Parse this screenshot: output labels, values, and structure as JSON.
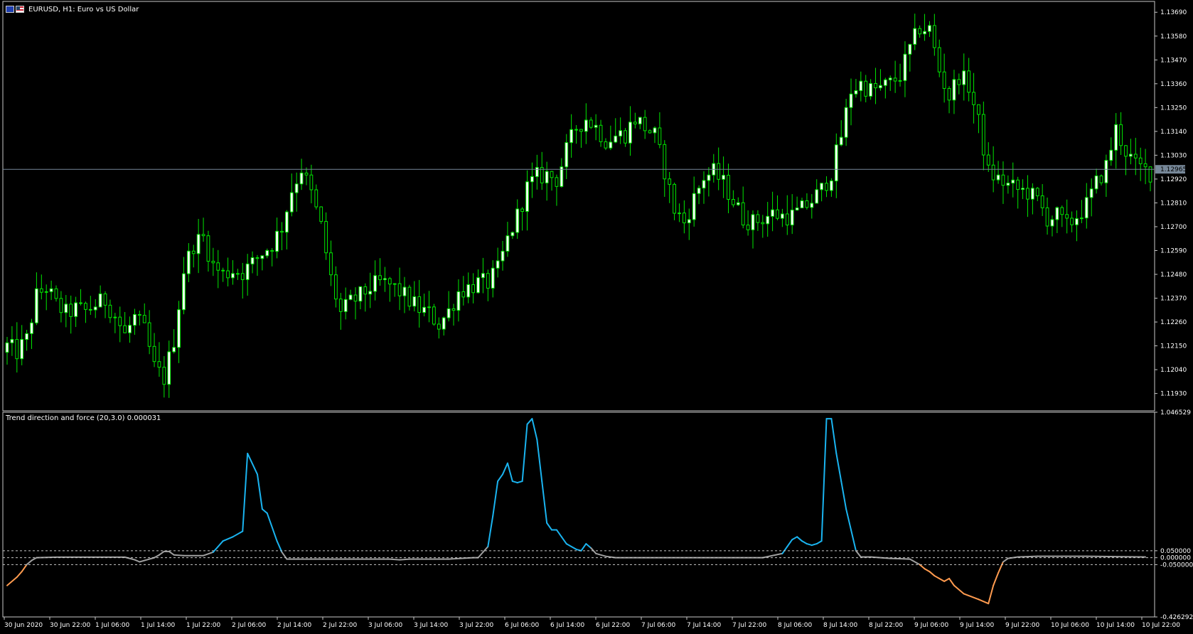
{
  "header": {
    "symbol_title": "EURUSD, H1:  Euro vs US Dollar",
    "flag_left_icon": "eu-flag-icon",
    "flag_right_icon": "us-flag-icon"
  },
  "price_pane": {
    "axis_labels": [
      "1.13690",
      "1.13580",
      "1.13470",
      "1.13360",
      "1.13250",
      "1.13140",
      "1.13030",
      "1.12920",
      "1.12810",
      "1.12700",
      "1.12590",
      "1.12480",
      "1.12370",
      "1.12260",
      "1.12150",
      "1.12040",
      "1.11930"
    ],
    "current_price_label": "1.12965",
    "current_price": 1.12965
  },
  "indicator_pane": {
    "title": "Trend direction and force (20,3.0) 0.000031",
    "axis_labels": [
      "1.046529",
      "0.050000",
      "0.000000",
      "-0.050000",
      "-0.426292"
    ]
  },
  "time_axis": {
    "labels": [
      "30 Jun 2020",
      "30 Jun 22:00",
      "1 Jul 06:00",
      "1 Jul 14:00",
      "1 Jul 22:00",
      "2 Jul 06:00",
      "2 Jul 14:00",
      "2 Jul 22:00",
      "3 Jul 06:00",
      "3 Jul 14:00",
      "3 Jul 22:00",
      "6 Jul 06:00",
      "6 Jul 14:00",
      "6 Jul 22:00",
      "7 Jul 06:00",
      "7 Jul 14:00",
      "7 Jul 22:00",
      "8 Jul 06:00",
      "8 Jul 14:00",
      "8 Jul 22:00",
      "9 Jul 06:00",
      "9 Jul 14:00",
      "9 Jul 22:00",
      "10 Jul 06:00",
      "10 Jul 14:00",
      "10 Jul 22:00"
    ]
  },
  "colors": {
    "background": "#000000",
    "grid_frame": "#c8c8c8",
    "candle_bull": "#ffffff",
    "candle_bear": "#000000",
    "wick": "#00e600",
    "ind_up": "#1ab4f0",
    "ind_flat": "#a0a0a0",
    "ind_down": "#ff9b4f",
    "price_line": "#778899"
  },
  "chart_data": [
    {
      "type": "candlestick",
      "title": "EURUSD, H1:  Euro vs US Dollar",
      "x_unit": "hour",
      "ylim": [
        1.1185,
        1.1374
      ],
      "anchors": [
        [
          0,
          1.1215
        ],
        [
          2,
          1.1212
        ],
        [
          4,
          1.1218
        ],
        [
          6,
          1.1238
        ],
        [
          8,
          1.1242
        ],
        [
          10,
          1.1234
        ],
        [
          12,
          1.123
        ],
        [
          14,
          1.1232
        ],
        [
          16,
          1.1231
        ],
        [
          18,
          1.1234
        ],
        [
          20,
          1.1236
        ],
        [
          22,
          1.1229
        ],
        [
          24,
          1.122
        ],
        [
          26,
          1.1228
        ],
        [
          28,
          1.1222
        ],
        [
          30,
          1.1205
        ],
        [
          32,
          1.12
        ],
        [
          34,
          1.1218
        ],
        [
          36,
          1.125
        ],
        [
          38,
          1.1262
        ],
        [
          40,
          1.1265
        ],
        [
          42,
          1.1252
        ],
        [
          44,
          1.1248
        ],
        [
          46,
          1.125
        ],
        [
          48,
          1.1249
        ],
        [
          50,
          1.1253
        ],
        [
          52,
          1.1258
        ],
        [
          54,
          1.1262
        ],
        [
          56,
          1.127
        ],
        [
          58,
          1.1287
        ],
        [
          60,
          1.1297
        ],
        [
          62,
          1.1285
        ],
        [
          64,
          1.127
        ],
        [
          66,
          1.1246
        ],
        [
          68,
          1.123
        ],
        [
          70,
          1.1235
        ],
        [
          72,
          1.1238
        ],
        [
          74,
          1.1242
        ],
        [
          76,
          1.1244
        ],
        [
          78,
          1.1243
        ],
        [
          80,
          1.124
        ],
        [
          82,
          1.1236
        ],
        [
          84,
          1.1232
        ],
        [
          86,
          1.123
        ],
        [
          88,
          1.1225
        ],
        [
          90,
          1.1231
        ],
        [
          92,
          1.124
        ],
        [
          94,
          1.1242
        ],
        [
          96,
          1.1244
        ],
        [
          98,
          1.1244
        ],
        [
          100,
          1.125
        ],
        [
          102,
          1.1264
        ],
        [
          104,
          1.1275
        ],
        [
          106,
          1.1288
        ],
        [
          108,
          1.1293
        ],
        [
          110,
          1.1294
        ],
        [
          112,
          1.1292
        ],
        [
          114,
          1.1305
        ],
        [
          116,
          1.1316
        ],
        [
          118,
          1.132
        ],
        [
          120,
          1.1316
        ],
        [
          122,
          1.131
        ],
        [
          124,
          1.1312
        ],
        [
          126,
          1.1313
        ],
        [
          128,
          1.132
        ],
        [
          130,
          1.1316
        ],
        [
          132,
          1.1312
        ],
        [
          134,
          1.1296
        ],
        [
          136,
          1.1278
        ],
        [
          138,
          1.1272
        ],
        [
          140,
          1.1283
        ],
        [
          142,
          1.1293
        ],
        [
          144,
          1.1295
        ],
        [
          146,
          1.129
        ],
        [
          148,
          1.1282
        ],
        [
          150,
          1.1274
        ],
        [
          152,
          1.1272
        ],
        [
          154,
          1.1274
        ],
        [
          156,
          1.1276
        ],
        [
          158,
          1.1275
        ],
        [
          160,
          1.1275
        ],
        [
          162,
          1.1278
        ],
        [
          164,
          1.1282
        ],
        [
          166,
          1.1287
        ],
        [
          168,
          1.1295
        ],
        [
          170,
          1.1312
        ],
        [
          172,
          1.1333
        ],
        [
          174,
          1.1336
        ],
        [
          176,
          1.1333
        ],
        [
          178,
          1.1334
        ],
        [
          180,
          1.1336
        ],
        [
          182,
          1.134
        ],
        [
          184,
          1.1352
        ],
        [
          186,
          1.1362
        ],
        [
          188,
          1.1361
        ],
        [
          190,
          1.1342
        ],
        [
          192,
          1.133
        ],
        [
          194,
          1.134
        ],
        [
          196,
          1.1335
        ],
        [
          198,
          1.1318
        ],
        [
          200,
          1.1295
        ],
        [
          202,
          1.1292
        ],
        [
          204,
          1.1289
        ],
        [
          206,
          1.1287
        ],
        [
          208,
          1.1286
        ],
        [
          210,
          1.1282
        ],
        [
          212,
          1.1274
        ],
        [
          214,
          1.1275
        ],
        [
          216,
          1.127
        ],
        [
          218,
          1.1275
        ],
        [
          220,
          1.128
        ],
        [
          222,
          1.129
        ],
        [
          224,
          1.1298
        ],
        [
          226,
          1.1315
        ],
        [
          228,
          1.1305
        ],
        [
          230,
          1.1298
        ],
        [
          232,
          1.1296
        ],
        [
          233,
          1.1295
        ]
      ]
    },
    {
      "type": "line",
      "title": "Trend direction and force (20,3.0) 0.000031",
      "x_unit": "hour",
      "ylim": [
        -0.426292,
        1.046529
      ],
      "thresholds": [
        0.05,
        0.0,
        -0.05
      ],
      "points": [
        [
          0,
          -0.2
        ],
        [
          2,
          -0.14
        ],
        [
          3,
          -0.1
        ],
        [
          4,
          -0.05
        ],
        [
          5,
          -0.02
        ],
        [
          6,
          0
        ],
        [
          10,
          0.004
        ],
        [
          24,
          0.004
        ],
        [
          26,
          -0.015
        ],
        [
          27,
          -0.03
        ],
        [
          28,
          -0.02
        ],
        [
          30,
          0
        ],
        [
          31,
          0.02
        ],
        [
          32,
          0.045
        ],
        [
          33,
          0.045
        ],
        [
          34,
          0.02
        ],
        [
          36,
          0.015
        ],
        [
          40,
          0.015
        ],
        [
          42,
          0.04
        ],
        [
          44,
          0.12
        ],
        [
          46,
          0.15
        ],
        [
          48,
          0.19
        ],
        [
          49,
          0.75
        ],
        [
          51,
          0.6
        ],
        [
          52,
          0.35
        ],
        [
          53,
          0.32
        ],
        [
          55,
          0.12
        ],
        [
          56,
          0.04
        ],
        [
          57,
          -0.01
        ],
        [
          59,
          -0.01
        ],
        [
          62,
          -0.01
        ],
        [
          78,
          -0.01
        ],
        [
          80,
          -0.015
        ],
        [
          82,
          -0.01
        ],
        [
          90,
          -0.01
        ],
        [
          95,
          0
        ],
        [
          96,
          0
        ],
        [
          98,
          0.08
        ],
        [
          99,
          0.3
        ],
        [
          100,
          0.55
        ],
        [
          101,
          0.6
        ],
        [
          102,
          0.68
        ],
        [
          103,
          0.55
        ],
        [
          104,
          0.54
        ],
        [
          105,
          0.55
        ],
        [
          106,
          0.96
        ],
        [
          107,
          1.0
        ],
        [
          108,
          0.85
        ],
        [
          109,
          0.55
        ],
        [
          110,
          0.25
        ],
        [
          111,
          0.2
        ],
        [
          112,
          0.2
        ],
        [
          113,
          0.15
        ],
        [
          114,
          0.1
        ],
        [
          116,
          0.06
        ],
        [
          117,
          0.05
        ],
        [
          118,
          0.1
        ],
        [
          119,
          0.07
        ],
        [
          120,
          0.03
        ],
        [
          122,
          0.01
        ],
        [
          124,
          0
        ],
        [
          128,
          0
        ],
        [
          134,
          0
        ],
        [
          150,
          0
        ],
        [
          154,
          0
        ],
        [
          158,
          0.03
        ],
        [
          159,
          0.08
        ],
        [
          160,
          0.13
        ],
        [
          161,
          0.15
        ],
        [
          162,
          0.12
        ],
        [
          163,
          0.1
        ],
        [
          164,
          0.09
        ],
        [
          165,
          0.1
        ],
        [
          166,
          0.12
        ],
        [
          167,
          1.0
        ],
        [
          168,
          1.0
        ],
        [
          169,
          0.75
        ],
        [
          170,
          0.55
        ],
        [
          171,
          0.35
        ],
        [
          172,
          0.2
        ],
        [
          173,
          0.05
        ],
        [
          174,
          0.005
        ],
        [
          176,
          0.005
        ],
        [
          180,
          -0.005
        ],
        [
          184,
          -0.01
        ],
        [
          186,
          -0.05
        ],
        [
          187,
          -0.08
        ],
        [
          188,
          -0.1
        ],
        [
          189,
          -0.13
        ],
        [
          190,
          -0.15
        ],
        [
          191,
          -0.17
        ],
        [
          192,
          -0.15
        ],
        [
          193,
          -0.2
        ],
        [
          195,
          -0.26
        ],
        [
          198,
          -0.3
        ],
        [
          200,
          -0.33
        ],
        [
          201,
          -0.2
        ],
        [
          202,
          -0.11
        ],
        [
          203,
          -0.03
        ],
        [
          204,
          -0.005
        ],
        [
          206,
          0.005
        ],
        [
          210,
          0.01
        ],
        [
          220,
          0.01
        ],
        [
          232,
          0.005
        ]
      ]
    }
  ]
}
